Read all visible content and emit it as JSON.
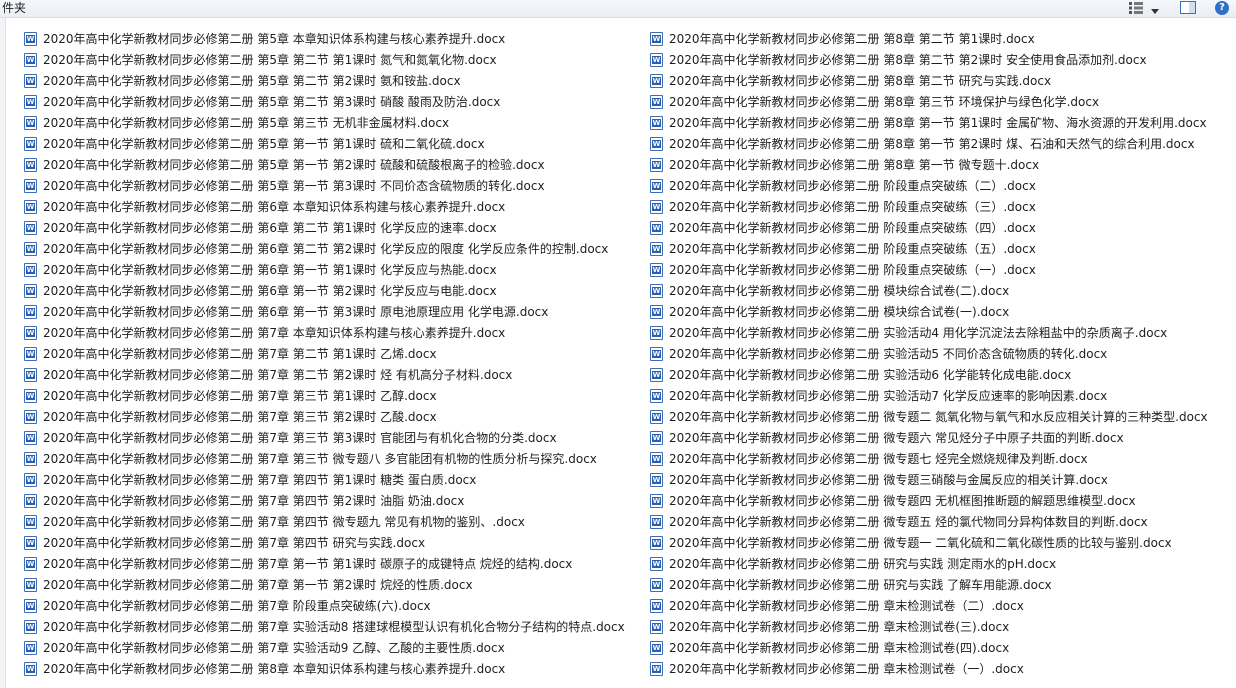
{
  "toolbar": {
    "title_fragment": "件夹"
  },
  "files": {
    "left": [
      "2020年高中化学新教材同步必修第二册  第5章 本章知识体系构建与核心素养提升.docx",
      "2020年高中化学新教材同步必修第二册  第5章 第二节 第1课时   氮气和氮氧化物.docx",
      "2020年高中化学新教材同步必修第二册  第5章 第二节 第2课时   氨和铵盐.docx",
      "2020年高中化学新教材同步必修第二册  第5章 第二节 第3课时   硝酸   酸雨及防治.docx",
      "2020年高中化学新教材同步必修第二册  第5章 第三节   无机非金属材料.docx",
      "2020年高中化学新教材同步必修第二册  第5章 第一节 第1课时   硫和二氧化硫.docx",
      "2020年高中化学新教材同步必修第二册  第5章 第一节 第2课时   硫酸和硫酸根离子的检验.docx",
      "2020年高中化学新教材同步必修第二册  第5章 第一节 第3课时   不同价态含硫物质的转化.docx",
      "2020年高中化学新教材同步必修第二册  第6章 本章知识体系构建与核心素养提升.docx",
      "2020年高中化学新教材同步必修第二册  第6章 第二节 第1课时   化学反应的速率.docx",
      "2020年高中化学新教材同步必修第二册  第6章 第二节 第2课时   化学反应的限度   化学反应条件的控制.docx",
      "2020年高中化学新教材同步必修第二册  第6章 第一节 第1课时   化学反应与热能.docx",
      "2020年高中化学新教材同步必修第二册  第6章 第一节 第2课时   化学反应与电能.docx",
      "2020年高中化学新教材同步必修第二册  第6章 第一节 第3课时   原电池原理应用   化学电源.docx",
      "2020年高中化学新教材同步必修第二册  第7章 本章知识体系构建与核心素养提升.docx",
      "2020年高中化学新教材同步必修第二册  第7章 第二节 第1课时   乙烯.docx",
      "2020年高中化学新教材同步必修第二册  第7章 第二节 第2课时   烃   有机高分子材料.docx",
      "2020年高中化学新教材同步必修第二册  第7章 第三节 第1课时   乙醇.docx",
      "2020年高中化学新教材同步必修第二册  第7章 第三节 第2课时   乙酸.docx",
      "2020年高中化学新教材同步必修第二册  第7章 第三节 第3课时   官能团与有机化合物的分类.docx",
      "2020年高中化学新教材同步必修第二册  第7章 第三节 微专题八   多官能团有机物的性质分析与探究.docx",
      "2020年高中化学新教材同步必修第二册  第7章 第四节 第1课时   糖类   蛋白质.docx",
      "2020年高中化学新教材同步必修第二册  第7章 第四节 第2课时   油脂   奶油.docx",
      "2020年高中化学新教材同步必修第二册  第7章 第四节 微专题九   常见有机物的鉴别、.docx",
      "2020年高中化学新教材同步必修第二册  第7章 第四节 研究与实践.docx",
      "2020年高中化学新教材同步必修第二册  第7章 第一节 第1课时   碳原子的成键特点   烷烃的结构.docx",
      "2020年高中化学新教材同步必修第二册  第7章 第一节 第2课时   烷烃的性质.docx",
      "2020年高中化学新教材同步必修第二册  第7章 阶段重点突破练(六).docx",
      "2020年高中化学新教材同步必修第二册  第7章 实验活动8   搭建球棍模型认识有机化合物分子结构的特点.docx",
      "2020年高中化学新教材同步必修第二册  第7章 实验活动9   乙醇、乙酸的主要性质.docx",
      "2020年高中化学新教材同步必修第二册  第8章 本章知识体系构建与核心素养提升.docx"
    ],
    "right": [
      "2020年高中化学新教材同步必修第二册  第8章 第二节 第1课时.docx",
      "2020年高中化学新教材同步必修第二册  第8章 第二节 第2课时   安全使用食品添加剂.docx",
      "2020年高中化学新教材同步必修第二册  第8章 第二节 研究与实践.docx",
      "2020年高中化学新教材同步必修第二册  第8章 第三节   环境保护与绿色化学.docx",
      "2020年高中化学新教材同步必修第二册  第8章 第一节 第1课时   金属矿物、海水资源的开发利用.docx",
      "2020年高中化学新教材同步必修第二册  第8章 第一节 第2课时   煤、石油和天然气的综合利用.docx",
      "2020年高中化学新教材同步必修第二册  第8章 第一节 微专题十.docx",
      "2020年高中化学新教材同步必修第二册  阶段重点突破练（二）.docx",
      "2020年高中化学新教材同步必修第二册  阶段重点突破练（三）.docx",
      "2020年高中化学新教材同步必修第二册  阶段重点突破练（四）.docx",
      "2020年高中化学新教材同步必修第二册  阶段重点突破练（五）.docx",
      "2020年高中化学新教材同步必修第二册  阶段重点突破练（一）.docx",
      "2020年高中化学新教材同步必修第二册  模块综合试卷(二).docx",
      "2020年高中化学新教材同步必修第二册  模块综合试卷(一).docx",
      "2020年高中化学新教材同步必修第二册  实验活动4   用化学沉淀法去除粗盐中的杂质离子.docx",
      "2020年高中化学新教材同步必修第二册  实验活动5   不同价态含硫物质的转化.docx",
      "2020年高中化学新教材同步必修第二册  实验活动6   化学能转化成电能.docx",
      "2020年高中化学新教材同步必修第二册  实验活动7   化学反应速率的影响因素.docx",
      "2020年高中化学新教材同步必修第二册  微专题二  氮氧化物与氧气和水反应相关计算的三种类型.docx",
      "2020年高中化学新教材同步必修第二册  微专题六  常见烃分子中原子共面的判断.docx",
      "2020年高中化学新教材同步必修第二册  微专题七  烃完全燃烧规律及判断.docx",
      "2020年高中化学新教材同步必修第二册  微专题三硝酸与金属反应的相关计算.docx",
      "2020年高中化学新教材同步必修第二册  微专题四  无机框图推断题的解题思维模型.docx",
      "2020年高中化学新教材同步必修第二册  微专题五  烃的氯代物同分异构体数目的判断.docx",
      "2020年高中化学新教材同步必修第二册  微专题一  二氧化硫和二氧化碳性质的比较与鉴别.docx",
      "2020年高中化学新教材同步必修第二册  研究与实践 测定雨水的pH.docx",
      "2020年高中化学新教材同步必修第二册  研究与实践 了解车用能源.docx",
      "2020年高中化学新教材同步必修第二册  章末检测试卷（二）.docx",
      "2020年高中化学新教材同步必修第二册  章末检测试卷(三).docx",
      "2020年高中化学新教材同步必修第二册  章末检测试卷(四).docx",
      "2020年高中化学新教材同步必修第二册  章末检测试卷（一）.docx"
    ]
  }
}
